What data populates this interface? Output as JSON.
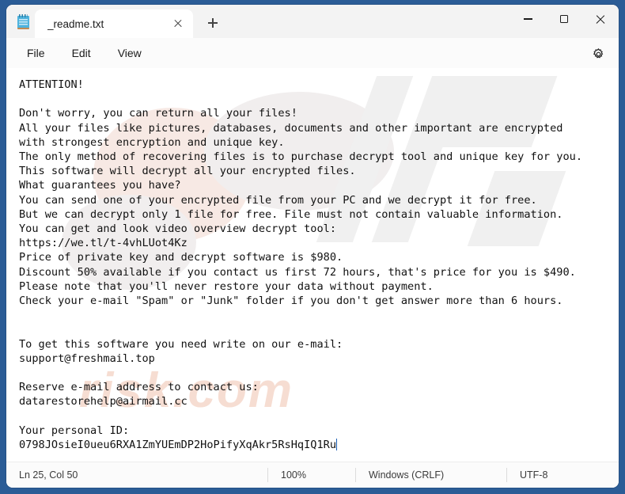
{
  "window": {
    "border_color": "#2b5c96",
    "app_icon": "notepad-icon"
  },
  "titlebar": {
    "tab": {
      "title": "_readme.txt",
      "close_icon": "close-icon"
    },
    "new_tab_icon": "plus-icon",
    "caption": {
      "minimize_icon": "minimize-icon",
      "maximize_icon": "maximize-icon",
      "close_icon": "close-icon"
    }
  },
  "menubar": {
    "items": [
      {
        "label": "File"
      },
      {
        "label": "Edit"
      },
      {
        "label": "View"
      }
    ],
    "settings_icon": "gear-icon"
  },
  "editor": {
    "watermark_text": "risk.com",
    "watermark_color": "#f6ddd2",
    "content": "ATTENTION!\n\nDon't worry, you can return all your files!\nAll your files like pictures, databases, documents and other important are encrypted\nwith strongest encryption and unique key.\nThe only method of recovering files is to purchase decrypt tool and unique key for you.\nThis software will decrypt all your encrypted files.\nWhat guarantees you have?\nYou can send one of your encrypted file from your PC and we decrypt it for free.\nBut we can decrypt only 1 file for free. File must not contain valuable information.\nYou can get and look video overview decrypt tool:\nhttps://we.tl/t-4vhLUot4Kz\nPrice of private key and decrypt software is $980.\nDiscount 50% available if you contact us first 72 hours, that's price for you is $490.\nPlease note that you'll never restore your data without payment.\nCheck your e-mail \"Spam\" or \"Junk\" folder if you don't get answer more than 6 hours.\n\n\nTo get this software you need write on our e-mail:\nsupport@freshmail.top\n\nReserve e-mail address to contact us:\ndatarestorehelp@airmail.cc\n\nYour personal ID:\n0798JOsieI0ueu6RXA1ZmYUEmDP2HoPifyXqAkr5RsHqIQ1Ru"
  },
  "statusbar": {
    "position": "Ln 25, Col 50",
    "zoom": "100%",
    "line_ending": "Windows (CRLF)",
    "encoding": "UTF-8"
  }
}
